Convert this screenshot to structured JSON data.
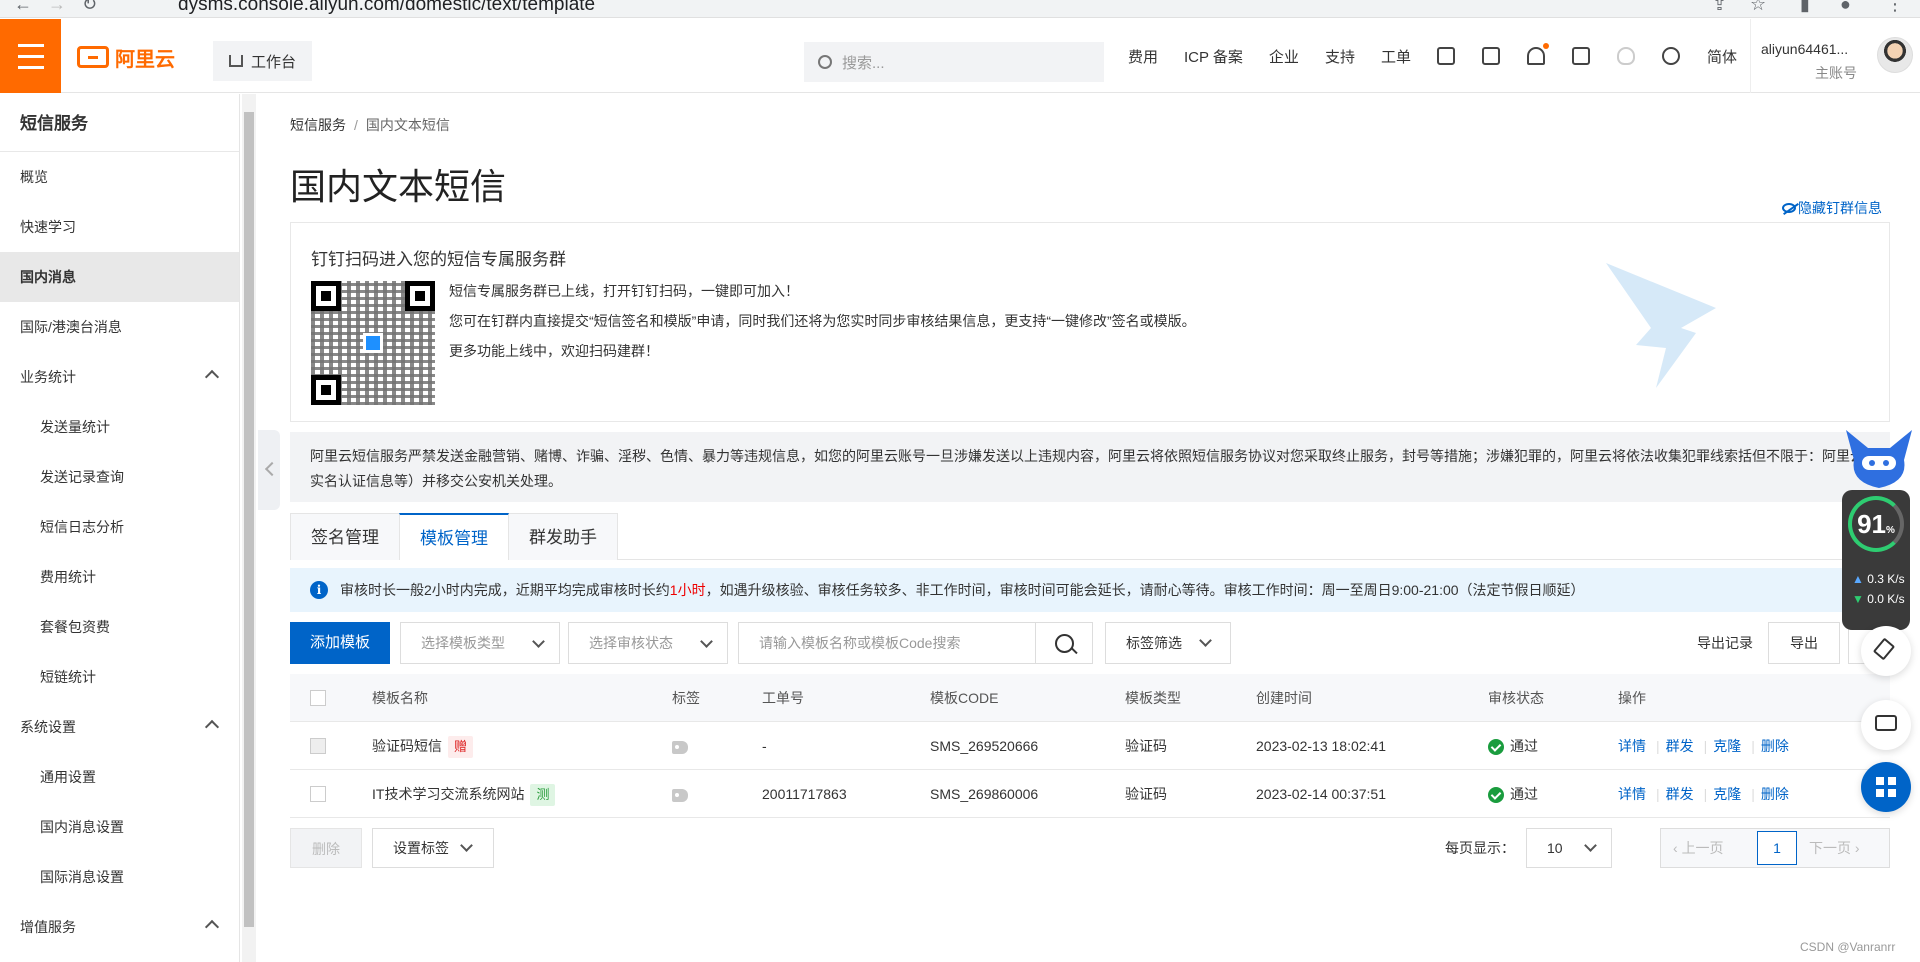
{
  "browser": {
    "url": "dysms.console.aliyun.com/domestic/text/template"
  },
  "header": {
    "logo_text": "阿里云",
    "workbench": "工作台",
    "search_placeholder": "搜索...",
    "links": [
      "费用",
      "ICP 备案",
      "企业",
      "支持",
      "工单"
    ],
    "lang": "简体",
    "username": "aliyun64461...",
    "account_type": "主账号"
  },
  "sidebar": {
    "title": "短信服务",
    "items": [
      {
        "label": "概览"
      },
      {
        "label": "快速学习"
      },
      {
        "label": "国内消息"
      },
      {
        "label": "国际/港澳台消息"
      },
      {
        "label": "业务统计"
      },
      {
        "label": "发送量统计"
      },
      {
        "label": "发送记录查询"
      },
      {
        "label": "短信日志分析"
      },
      {
        "label": "费用统计"
      },
      {
        "label": "套餐包资费"
      },
      {
        "label": "短链统计"
      },
      {
        "label": "系统设置"
      },
      {
        "label": "通用设置"
      },
      {
        "label": "国内消息设置"
      },
      {
        "label": "国际消息设置"
      },
      {
        "label": "增值服务"
      }
    ]
  },
  "main": {
    "breadcrumb": [
      "短信服务",
      "国内文本短信"
    ],
    "title": "国内文本短信",
    "hide_link": "隐藏钉群信息",
    "dingtalk": {
      "title": "钉钉扫码进入您的短信专属服务群",
      "line1": "短信专属服务群已上线，打开钉钉扫码，一键即可加入！",
      "line2": "您可在钉群内直接提交“短信签名和模版”申请，同时我们还将为您实时同步审核结果信息，更支持“一键修改”签名或模版。",
      "line3": "更多功能上线中，欢迎扫码建群！"
    },
    "warning": "阿里云短信服务严禁发送金融营销、赌博、诈骗、淫秽、色情、暴力等违规信息，如您的阿里云账号一旦涉嫌发送以上违规内容，阿里云将依照短信服务协议对您采取终止服务，封号等措施；涉嫌犯罪的，阿里云将依法收集犯罪线索括但不限于：阿里云实名认证信息等）并移交公安机关处理。",
    "tabs": [
      "签名管理",
      "模板管理",
      "群发助手"
    ],
    "info": {
      "pre": "审核时长一般2小时内完成，近期平均完成审核时长约",
      "highlight": "1小时",
      "post": "，如遇升级核验、审核任务较多、非工作时间，审核时间可能会延长，请耐心等待。审核工作时间：周一至周日9:00-21:00（法定节假日顺延）"
    },
    "toolbar": {
      "add": "添加模板",
      "type_placeholder": "选择模板类型",
      "status_placeholder": "选择审核状态",
      "search_placeholder": "请输入模板名称或模板Code搜索",
      "tag_filter": "标签筛选",
      "export_record": "导出记录",
      "export": "导出"
    },
    "table": {
      "headers": [
        "模板名称",
        "标签",
        "工单号",
        "模板CODE",
        "模板类型",
        "创建时间",
        "审核状态",
        "操作"
      ],
      "rows": [
        {
          "name": "验证码短信",
          "badge": "赠",
          "order": "-",
          "code": "SMS_269520666",
          "type": "验证码",
          "created": "2023-02-13 18:02:41",
          "status": "通过"
        },
        {
          "name": "IT技术学习交流系统网站",
          "badge": "测",
          "order": "20011717863",
          "code": "SMS_269860006",
          "type": "验证码",
          "created": "2023-02-14 00:37:51",
          "status": "通过"
        }
      ],
      "ops": [
        "详情",
        "群发",
        "克隆",
        "删除"
      ]
    },
    "footer": {
      "delete": "删除",
      "set_tag": "设置标签",
      "per_page_label": "每页显示：",
      "per_page": "10",
      "prev": "上一页",
      "page": "1",
      "next": "下一页"
    }
  },
  "widgets": {
    "percent": "91",
    "percent_unit": "%",
    "up_speed": "0.3",
    "down_speed": "0.0",
    "speed_unit": "K/s"
  },
  "watermark": "CSDN @Vanranrr"
}
